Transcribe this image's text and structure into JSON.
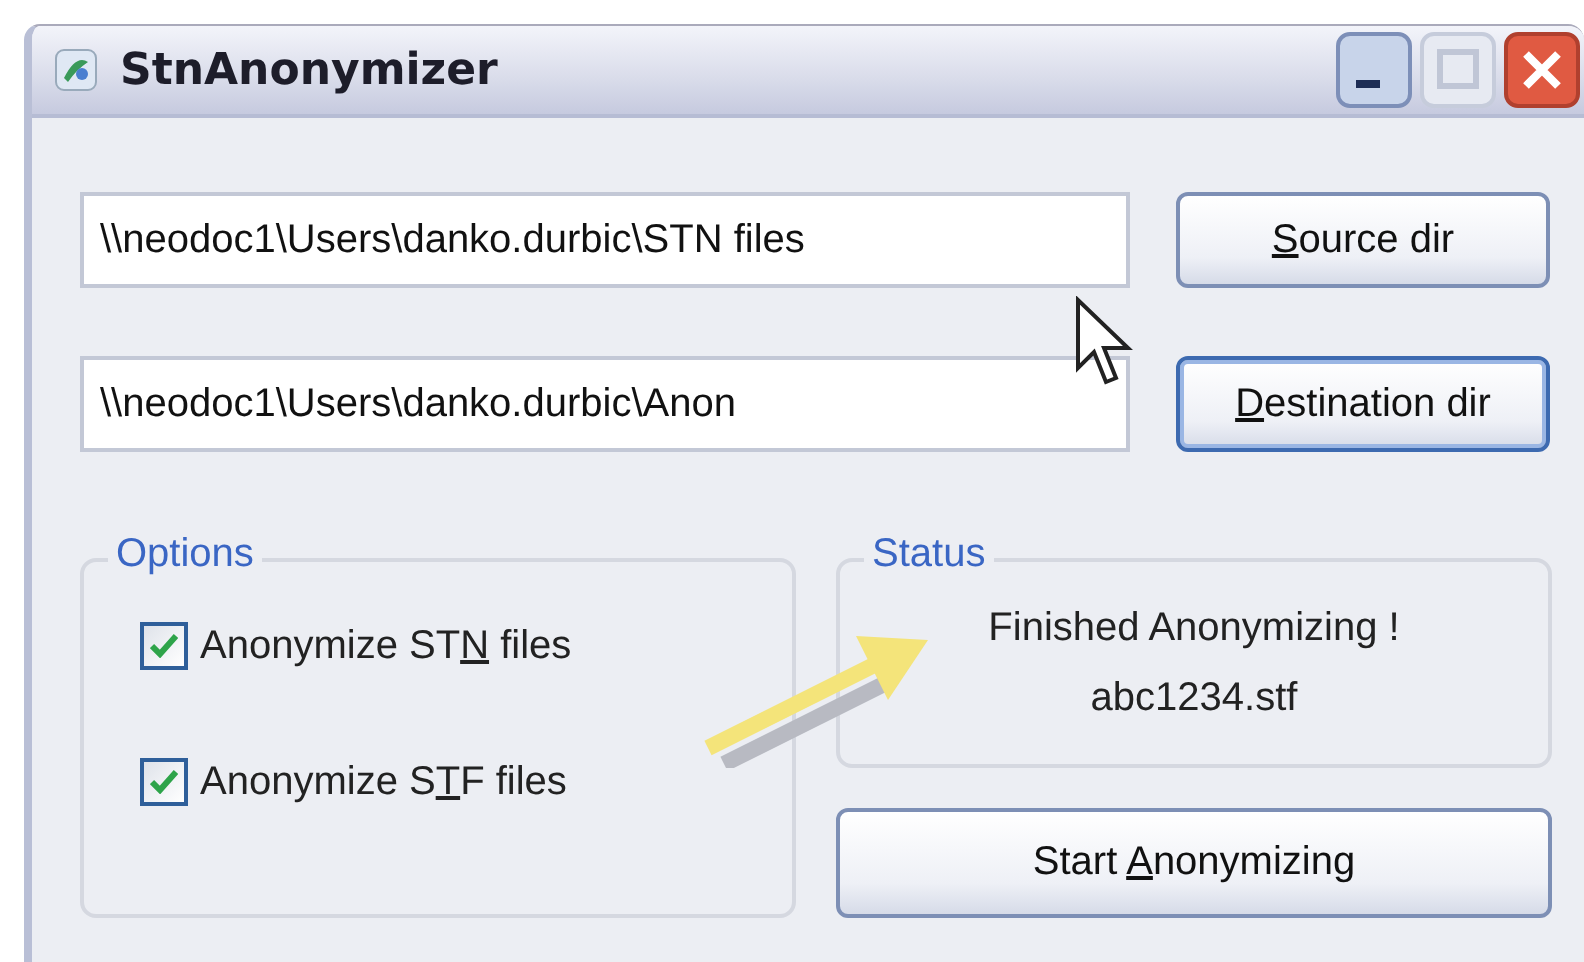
{
  "window": {
    "title": "StnAnonymizer"
  },
  "paths": [
    {
      "value": "\\\\neodoc1\\Users\\danko.durbic\\STN files",
      "button": {
        "mnemonic": "S",
        "after": "ource dir"
      },
      "focused": false
    },
    {
      "value": "\\\\neodoc1\\Users\\danko.durbic\\Anon",
      "button": {
        "mnemonic": "D",
        "after": "estination dir"
      },
      "focused": true
    }
  ],
  "options": {
    "legend": "Options",
    "checkboxes": [
      {
        "label": {
          "before": "Anonymize ST",
          "mnemonic": "N",
          "after": " files"
        },
        "checked": true
      },
      {
        "label": {
          "before": "Anonymize S",
          "mnemonic": "T",
          "after": "F files"
        },
        "checked": true
      }
    ]
  },
  "status": {
    "legend": "Status",
    "lines": [
      "Finished Anonymizing !",
      "abc1234.stf"
    ]
  },
  "start_button": {
    "before": "Start ",
    "mnemonic": "A",
    "after": "nonymizing"
  }
}
